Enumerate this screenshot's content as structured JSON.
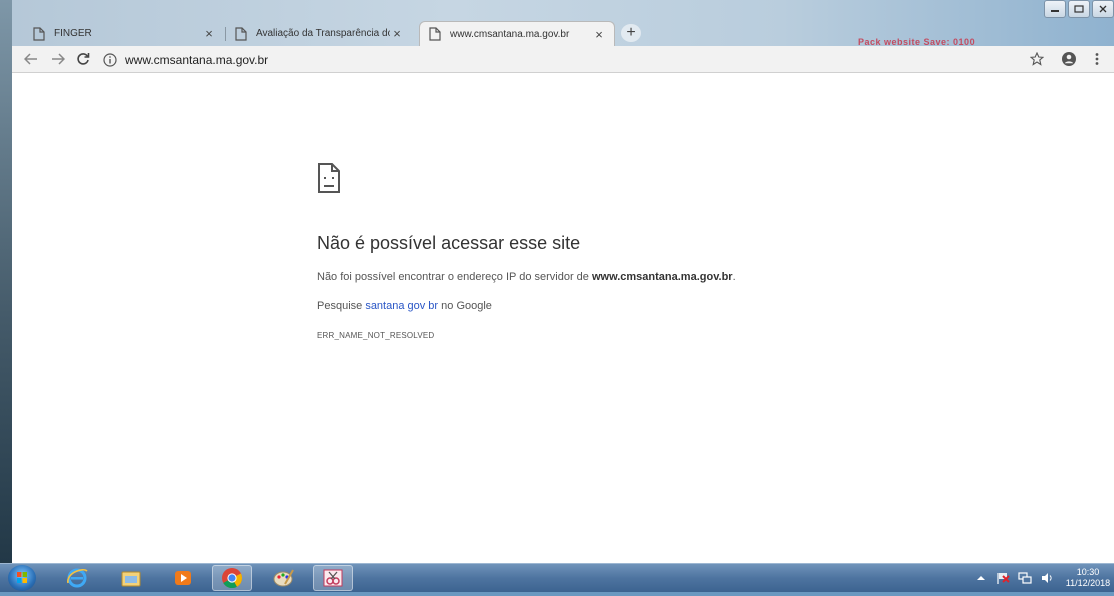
{
  "browser": {
    "tabs": [
      {
        "label": "FINGER",
        "active": false
      },
      {
        "label": "Avaliação da Transparência dos :",
        "active": false
      },
      {
        "label": "www.cmsantana.ma.gov.br",
        "active": true
      }
    ],
    "close_glyph": "×",
    "new_tab_glyph": "+",
    "address": "www.cmsantana.ma.gov.br",
    "caption_text": "Pack website Save: 0100",
    "toolbar_icons": [
      "back-arrow-icon",
      "forward-arrow-icon",
      "reload-icon",
      "info-icon",
      "star-icon",
      "account-icon",
      "menu-icon"
    ]
  },
  "error_page": {
    "title": "Não é possível acessar esse site",
    "desc_prefix": "Não foi possível encontrar o endereço IP do servidor de ",
    "desc_domain": "www.cmsantana.ma.gov.br",
    "desc_suffix": ".",
    "search_prefix": "Pesquise ",
    "search_link": "santana gov br",
    "search_suffix": " no Google",
    "error_code": "ERR_NAME_NOT_RESOLVED"
  },
  "taskbar": {
    "apps": [
      "ie-icon",
      "file-explorer-icon",
      "media-player-icon",
      "chrome-icon",
      "paint-icon",
      "snipping-tool-icon"
    ],
    "active_app": "chrome-icon",
    "clock_time": "10:30",
    "clock_date": "11/12/2018"
  },
  "colors": {
    "link": "#2a56c6",
    "error_title": "#333333",
    "caption": "#c24c61"
  }
}
